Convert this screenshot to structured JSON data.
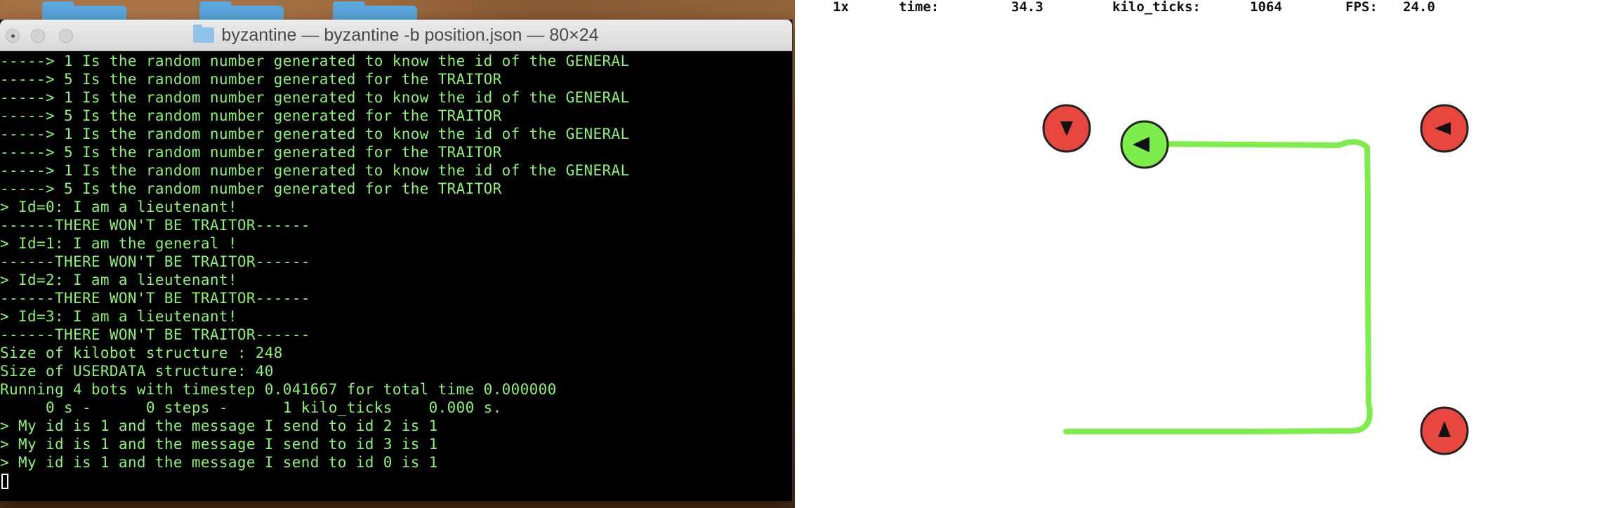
{
  "terminal": {
    "title": "byzantine — byzantine -b position.json — 80×24",
    "lines": [
      "-----> 1 Is the random number generated to know the id of the GENERAL",
      "-----> 5 Is the random number generated for the TRAITOR",
      "-----> 1 Is the random number generated to know the id of the GENERAL",
      "-----> 5 Is the random number generated for the TRAITOR",
      "-----> 1 Is the random number generated to know the id of the GENERAL",
      "-----> 5 Is the random number generated for the TRAITOR",
      "-----> 1 Is the random number generated to know the id of the GENERAL",
      "-----> 5 Is the random number generated for the TRAITOR",
      "> Id=0: I am a lieutenant!",
      "------THERE WON'T BE TRAITOR------",
      "> Id=1: I am the general !",
      "------THERE WON'T BE TRAITOR------",
      "> Id=2: I am a lieutenant!",
      "------THERE WON'T BE TRAITOR------",
      "> Id=3: I am a lieutenant!",
      "------THERE WON'T BE TRAITOR------",
      "Size of kilobot structure : 248",
      "Size of USERDATA structure: 40",
      "Running 4 bots with timestep 0.041667 for total time 0.000000",
      "     0 s -      0 steps -      1 kilo_ticks    0.000 s.",
      "> My id is 1 and the message I send to id 2 is 1",
      "> My id is 1 and the message I send to id 3 is 1",
      "> My id is 1 and the message I send to id 0 is 1"
    ]
  },
  "hud": {
    "speed": "1x",
    "time_label": "time:",
    "time_value": "34.3",
    "ticks_label": "kilo_ticks:",
    "ticks_value": "1064",
    "fps_label": "FPS:",
    "fps_value": "24.0"
  },
  "colors": {
    "terminal_text": "#8cf272",
    "robot_red": "#e8473f",
    "robot_green": "#7ded4b",
    "trail": "#7ded4b"
  },
  "icons": {
    "robot_heading": "triangle-arrow-icon",
    "folder": "folder-icon"
  }
}
